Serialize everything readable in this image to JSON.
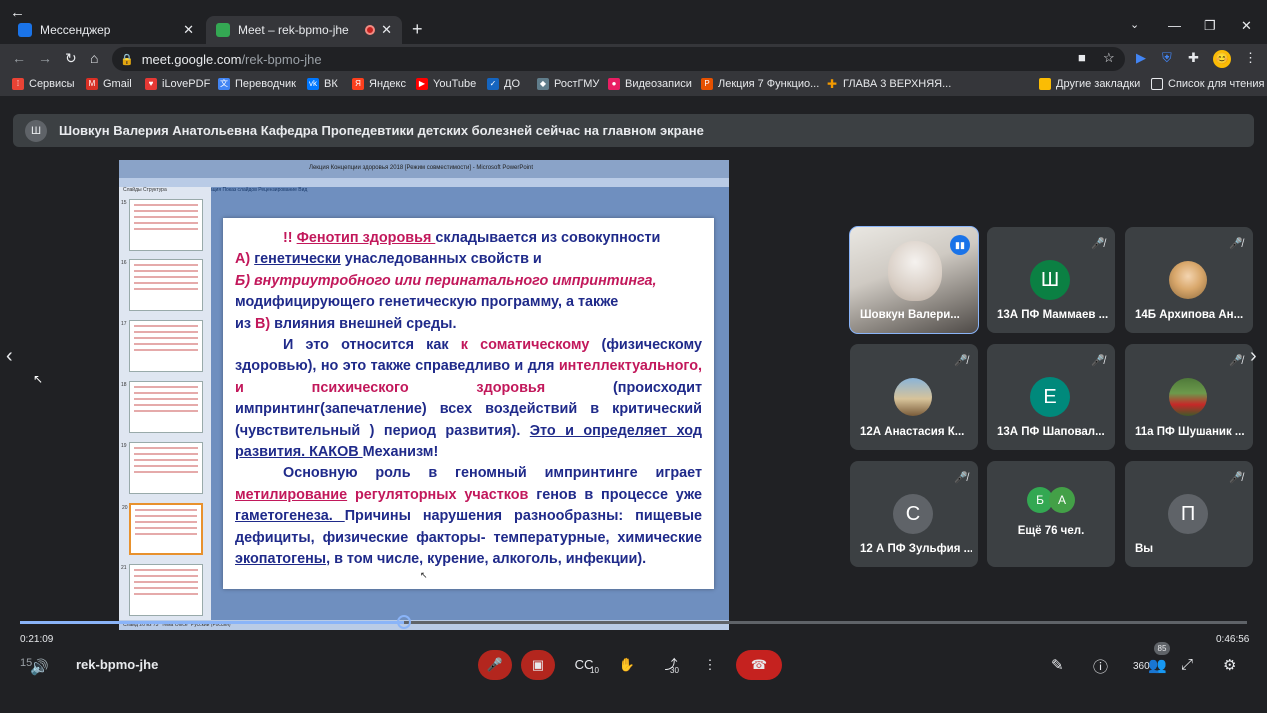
{
  "browser": {
    "tabs": [
      {
        "title": "Мессенджер"
      },
      {
        "title": "Meet – rek-bpmo-jhe"
      }
    ],
    "address": {
      "host": "meet.google.com",
      "path": "/rek-bpmo-jhe"
    },
    "bookmarks": [
      "Сервисы",
      "Gmail",
      "iLovePDF",
      "Переводчик",
      "ВК",
      "Яндекс",
      "YouTube",
      "ДО",
      "РостГМУ",
      "Видеозаписи",
      "Лекция 7 Функцио...",
      "ГЛАВА 3 ВЕРХНЯЯ..."
    ],
    "bookmarks_right": [
      "Другие закладки",
      "Список для чтения"
    ],
    "profile_initial": "😊"
  },
  "meet": {
    "banner": {
      "initial": "Ш",
      "text": "Шовкун Валерия Анатольевна Кафедра Пропедевтики детских болезней сейчас на главном экране"
    },
    "ppt": {
      "window_title": "Лекция Концепции здоровья 2018 [Режим совместимости] - Microsoft PowerPoint",
      "ribbon": "Главная   Вставка   Дизайн   Анимация   Показ слайдов   Рецензирование   Вид",
      "panel_tabs": "Слайды   Структура",
      "status": "Слайд 20 из 73    \"Тема Office\"    Русский (Россия)",
      "thumb_numbers": [
        "15",
        "16",
        "17",
        "18",
        "19",
        "20",
        "21"
      ]
    },
    "slide": {
      "p1_mark": "!! ",
      "p1_link": "Фенотип здоровья ",
      "p1_rest": "складывается из совокупности",
      "p2_label": "А) ",
      "p2_link": "генетически",
      "p2_rest": " унаследованных свойств и",
      "p3": "Б) внутриутробного или перинатального импринтинга,",
      "p4": "модифицирующего генетическую программу,  а также",
      "p5_pre": " из ",
      "p5_label": "В)",
      "p5_rest": " влияния внешней среды.",
      "p6_a": "И это относится как ",
      "p6_red": "к соматическому",
      "p6_b": "  (физическому здоровью),  но  это  также   справедливо  и  для ",
      "p6_red2": "интеллектуального, и психического здоровья",
      "p6_c": " (происходит импринтинг(запечатление) всех воздействий в критический (чувствительный ) период  развития). ",
      "p6_u": "Это и определяет ход развития.  КАКОВ ",
      "p6_end": " Механизм!",
      "p7_a": "Основную роль в геномный импринтинге  играет ",
      "p7_red": "метилирование",
      "p7_red2": " регуляторных участков",
      "p7_b": " генов в процессе уже ",
      "p7_u": "гаметогенеза.  ",
      "p7_c": "Причины нарушения  разнообразны: пищевые дефициты, физические факторы- температурные, химические ",
      "p7_u2": "экопатогены",
      "p7_d": ", в том числе, курение, алкоголь, инфекции)."
    },
    "participants": [
      {
        "name": "Шовкун Валери...",
        "type": "video",
        "speaking": true
      },
      {
        "name": "13А ПФ Маммаев ...",
        "initial": "Ш",
        "color": "#0b8043",
        "muted": true
      },
      {
        "name": "14Б Архипова Ан...",
        "type": "photo",
        "muted": true
      },
      {
        "name": "12А Анастасия К...",
        "type": "photo",
        "muted": true
      },
      {
        "name": "13А ПФ Шаповал...",
        "initial": "Е",
        "color": "#00897b",
        "muted": true
      },
      {
        "name": "11а ПФ Шушаник ...",
        "type": "photo",
        "muted": true
      },
      {
        "name": "12 А ПФ Зульфия ...",
        "initial": "С",
        "color": "#5f6368",
        "muted": true
      },
      {
        "name": "Ещё 76 чел.",
        "initials": [
          "Б",
          "А"
        ]
      },
      {
        "name": "Вы",
        "initial": "П",
        "color": "#5f6368",
        "muted": true
      }
    ],
    "more_colors": [
      "#33a852",
      "#43a047"
    ],
    "talk_icon": "audio-bars-icon"
  },
  "player": {
    "elapsed": "0:21:09",
    "total": "0:46:56",
    "progress": 0.313,
    "meeting_code": "rek-bpmo-jhe",
    "speed": "15",
    "skip_back": "10",
    "skip_fwd": "30",
    "participants_count": "85",
    "quality": "360"
  },
  "colors": {
    "accent": "#8ab4f8",
    "danger": "#c5221f"
  }
}
